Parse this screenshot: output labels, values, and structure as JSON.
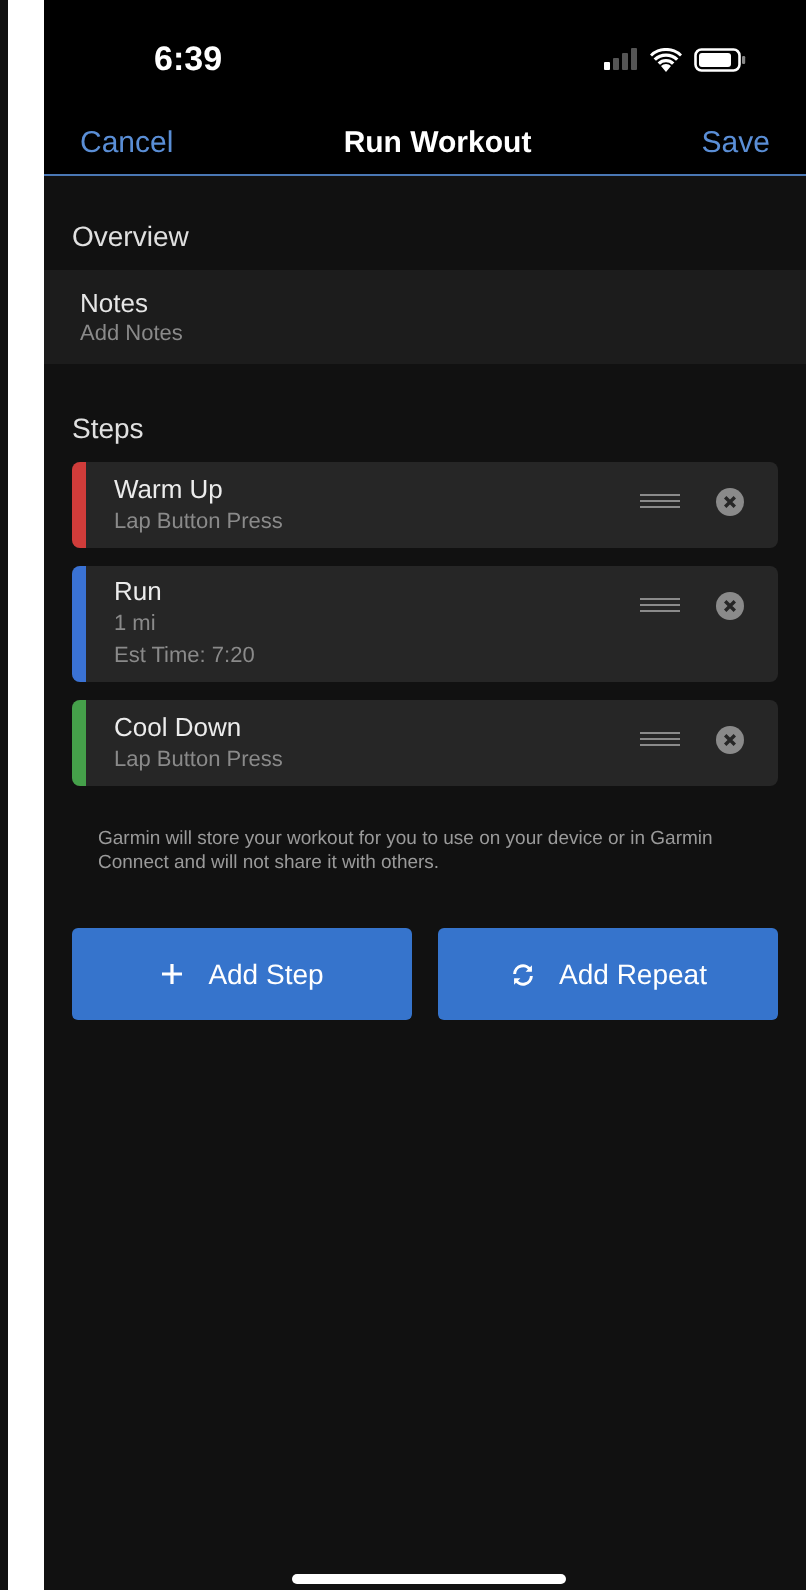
{
  "status_bar": {
    "time": "6:39"
  },
  "nav": {
    "cancel": "Cancel",
    "title": "Run Workout",
    "save": "Save"
  },
  "overview": {
    "heading": "Overview",
    "notes": {
      "label": "Notes",
      "placeholder": "Add Notes"
    }
  },
  "steps": {
    "heading": "Steps",
    "items": [
      {
        "name": "Warm Up",
        "details": [
          "Lap Button Press"
        ],
        "color": "#d03c3a"
      },
      {
        "name": "Run",
        "details": [
          "1 mi",
          "Est Time: 7:20"
        ],
        "color": "#3a72d4"
      },
      {
        "name": "Cool Down",
        "details": [
          "Lap Button Press"
        ],
        "color": "#45a04a"
      }
    ]
  },
  "disclaimer": "Garmin will store your workout for you to use on your device or in Garmin Connect and will not share it with others.",
  "buttons": [
    {
      "kind": "add",
      "label": "Add Step"
    },
    {
      "kind": "repeat",
      "label": "Add Repeat"
    }
  ]
}
